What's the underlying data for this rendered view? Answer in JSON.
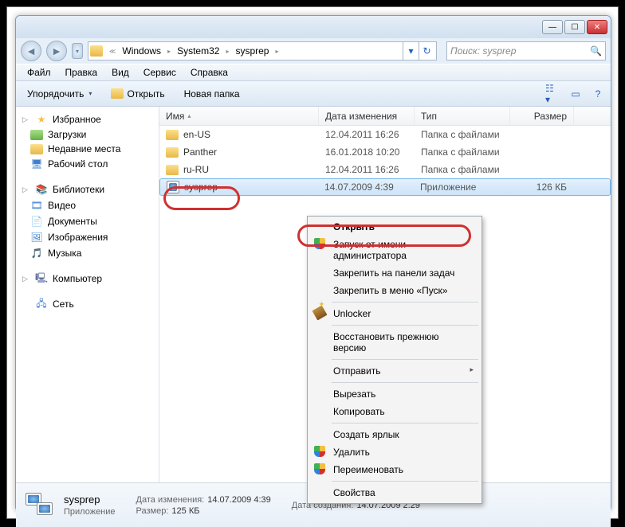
{
  "breadcrumb": {
    "parts": [
      "Windows",
      "System32",
      "sysprep"
    ],
    "search_placeholder": "Поиск: sysprep"
  },
  "menubar": [
    "Файл",
    "Правка",
    "Вид",
    "Сервис",
    "Справка"
  ],
  "toolbar": {
    "organize": "Упорядочить",
    "open": "Открыть",
    "newfolder": "Новая папка"
  },
  "sidebar": {
    "favorites": {
      "label": "Избранное",
      "items": [
        "Загрузки",
        "Недавние места",
        "Рабочий стол"
      ]
    },
    "libraries": {
      "label": "Библиотеки",
      "items": [
        "Видео",
        "Документы",
        "Изображения",
        "Музыка"
      ]
    },
    "computer": {
      "label": "Компьютер"
    },
    "network": {
      "label": "Сеть"
    }
  },
  "columns": {
    "name": "Имя",
    "date": "Дата изменения",
    "type": "Тип",
    "size": "Размер"
  },
  "rows": [
    {
      "name": "en-US",
      "date": "12.04.2011 16:26",
      "type": "Папка с файлами",
      "size": ""
    },
    {
      "name": "Panther",
      "date": "16.01.2018 10:20",
      "type": "Папка с файлами",
      "size": ""
    },
    {
      "name": "ru-RU",
      "date": "12.04.2011 16:26",
      "type": "Папка с файлами",
      "size": ""
    },
    {
      "name": "sysprep",
      "date": "14.07.2009 4:39",
      "type": "Приложение",
      "size": "126 КБ"
    }
  ],
  "context": {
    "open": "Открыть",
    "runas": "Запуск от имени администратора",
    "pintask": "Закрепить на панели задач",
    "pinstart": "Закрепить в меню «Пуск»",
    "unlocker": "Unlocker",
    "restore": "Восстановить прежнюю версию",
    "sendto": "Отправить",
    "cut": "Вырезать",
    "copy": "Копировать",
    "shortcut": "Создать ярлык",
    "delete": "Удалить",
    "rename": "Переименовать",
    "props": "Свойства"
  },
  "details": {
    "name": "sysprep",
    "type": "Приложение",
    "mod_label": "Дата изменения:",
    "mod_val": "14.07.2009 4:39",
    "size_label": "Размер:",
    "size_val": "125 КБ",
    "created_label": "Дата создания:",
    "created_val": "14.07.2009 2:29"
  }
}
